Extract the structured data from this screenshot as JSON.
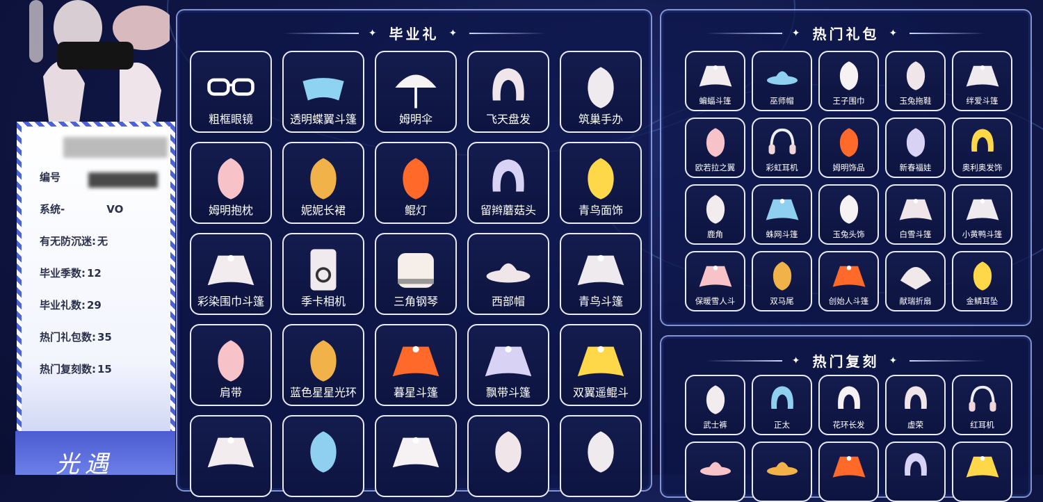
{
  "profile": {
    "rows": [
      {
        "label": "编号",
        "value": ""
      },
      {
        "label": "系统-",
        "value": "VO"
      },
      {
        "label": "有无防沉迷:",
        "value": "无"
      },
      {
        "label": "毕业季数:",
        "value": "12"
      },
      {
        "label": "毕业礼数:",
        "value": "29"
      },
      {
        "label": "热门礼包数:",
        "value": "35"
      },
      {
        "label": "热门复刻数:",
        "value": "15"
      }
    ],
    "signature": "光遇"
  },
  "graduation": {
    "title": "毕业礼",
    "items": [
      {
        "label": "粗框眼镜",
        "icon": "glasses-icon"
      },
      {
        "label": "透明蝶翼斗篷",
        "icon": "butterfly-cape-icon"
      },
      {
        "label": "姆明伞",
        "icon": "umbrella-icon"
      },
      {
        "label": "飞天盘发",
        "icon": "hair-bun-icon"
      },
      {
        "label": "筑巢手办",
        "icon": "figurine-icon"
      },
      {
        "label": "姆明抱枕",
        "icon": "moomin-pillow-icon"
      },
      {
        "label": "妮妮长裙",
        "icon": "long-dress-icon"
      },
      {
        "label": "鲲灯",
        "icon": "lantern-icon"
      },
      {
        "label": "留辫蘑菇头",
        "icon": "mushroom-hair-icon"
      },
      {
        "label": "青鸟面饰",
        "icon": "bird-mask-icon"
      },
      {
        "label": "彩染围巾斗篷",
        "icon": "scarf-cape-icon"
      },
      {
        "label": "季卡相机",
        "icon": "camera-icon"
      },
      {
        "label": "三角钢琴",
        "icon": "piano-icon"
      },
      {
        "label": "西部帽",
        "icon": "cowboy-hat-icon"
      },
      {
        "label": "青鸟斗篷",
        "icon": "bluebird-cape-icon"
      },
      {
        "label": "肩带",
        "icon": "shoulder-strap-icon"
      },
      {
        "label": "蓝色星星光环",
        "icon": "star-halo-icon"
      },
      {
        "label": "暮星斗篷",
        "icon": "dusk-star-cape-icon"
      },
      {
        "label": "飘带斗篷",
        "icon": "ribbon-cape-icon"
      },
      {
        "label": "双翼遥鲲斗",
        "icon": "wing-cape-icon"
      },
      {
        "label": "",
        "icon": "layered-cape-icon"
      },
      {
        "label": "",
        "icon": "horn-mask-icon"
      },
      {
        "label": "",
        "icon": "pink-cape-icon"
      },
      {
        "label": "",
        "icon": "robe-icon"
      },
      {
        "label": "",
        "icon": "outfit-icon"
      }
    ]
  },
  "hot_packs": {
    "title": "热门礼包",
    "items": [
      {
        "label": "蝙蝠斗篷",
        "icon": "bat-cape-icon"
      },
      {
        "label": "巫师帽",
        "icon": "witch-hat-icon"
      },
      {
        "label": "王子围巾",
        "icon": "prince-scarf-icon"
      },
      {
        "label": "玉兔拖鞋",
        "icon": "rabbit-slippers-icon"
      },
      {
        "label": "绊爱斗篷",
        "icon": "heart-cape-icon"
      },
      {
        "label": "欧若拉之翼",
        "icon": "aurora-wing-icon"
      },
      {
        "label": "彩虹耳机",
        "icon": "rainbow-headphones-icon"
      },
      {
        "label": "姆明饰品",
        "icon": "moomin-accessory-icon"
      },
      {
        "label": "新春福娃",
        "icon": "spring-doll-icon"
      },
      {
        "label": "奥利奥发饰",
        "icon": "oreo-hairpin-icon"
      },
      {
        "label": "鹿角",
        "icon": "antler-icon"
      },
      {
        "label": "蛛网斗篷",
        "icon": "web-cape-icon"
      },
      {
        "label": "玉兔头饰",
        "icon": "rabbit-headpiece-icon"
      },
      {
        "label": "白雪斗篷",
        "icon": "snow-cape-icon"
      },
      {
        "label": "小黄鸭斗篷",
        "icon": "duck-cape-icon"
      },
      {
        "label": "保暖雪人斗",
        "icon": "snowman-cape-icon"
      },
      {
        "label": "双马尾",
        "icon": "twin-tails-icon"
      },
      {
        "label": "创始人斗篷",
        "icon": "founder-cape-icon"
      },
      {
        "label": "献瑞折扇",
        "icon": "folding-fan-icon"
      },
      {
        "label": "金鳞耳坠",
        "icon": "earring-icon"
      }
    ]
  },
  "hot_reruns": {
    "title": "热门复刻",
    "items": [
      {
        "label": "武士裤",
        "icon": "samurai-pants-icon"
      },
      {
        "label": "正太",
        "icon": "short-hair-icon"
      },
      {
        "label": "花环长发",
        "icon": "flower-hair-icon"
      },
      {
        "label": "虚荣",
        "icon": "vanity-hair-icon"
      },
      {
        "label": "红耳机",
        "icon": "red-headphones-icon"
      },
      {
        "label": "",
        "icon": "straw-hat-icon"
      },
      {
        "label": "",
        "icon": "bamboo-hat-icon"
      },
      {
        "label": "",
        "icon": "cape-icon"
      },
      {
        "label": "",
        "icon": "bun-hair-icon"
      },
      {
        "label": "",
        "icon": "dark-cape-icon"
      }
    ]
  }
}
